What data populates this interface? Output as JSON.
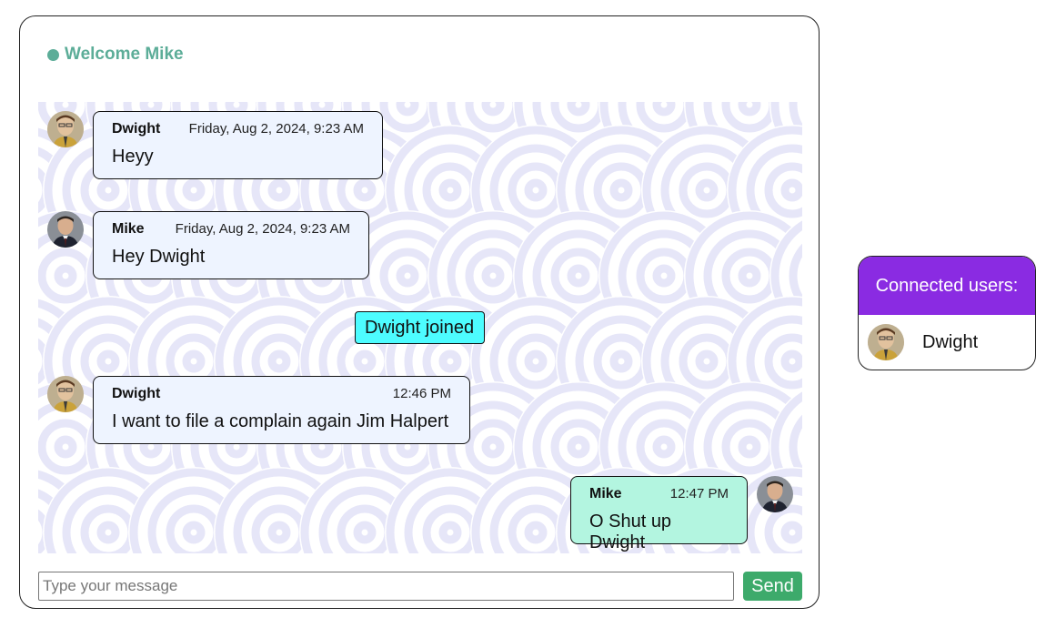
{
  "header": {
    "welcome_text": "Welcome Mike",
    "status_icon": "online-dot-icon",
    "accent_color": "#5cad98"
  },
  "messages": [
    {
      "type": "chat",
      "side": "left",
      "sender": "Dwight",
      "time": "Friday, Aug 2, 2024, 9:23 AM",
      "text": "Heyy",
      "avatar": "dwight-avatar",
      "bubble_color": "#eef4ff"
    },
    {
      "type": "chat",
      "side": "left",
      "sender": "Mike",
      "time": "Friday, Aug 2, 2024, 9:23 AM",
      "text": "Hey Dwight",
      "avatar": "mike-avatar",
      "bubble_color": "#eef4ff"
    },
    {
      "type": "system",
      "text": "Dwight joined",
      "bubble_color": "#4dfcff"
    },
    {
      "type": "chat",
      "side": "left",
      "sender": "Dwight",
      "time": "12:46 PM",
      "text": "I want to file a complain again Jim Halpert",
      "avatar": "dwight-avatar",
      "bubble_color": "#eef4ff"
    },
    {
      "type": "chat",
      "side": "right",
      "sender": "Mike",
      "time": "12:47 PM",
      "text": "O Shut up Dwight",
      "avatar": "mike-avatar",
      "bubble_color": "#b3f5e0"
    }
  ],
  "composer": {
    "placeholder": "Type your message",
    "value": "",
    "send_label": "Send",
    "send_color": "#3daa6b"
  },
  "connected_users": {
    "title": "Connected users:",
    "header_color": "#8a2be2",
    "users": [
      {
        "name": "Dwight",
        "avatar": "dwight-avatar"
      }
    ]
  },
  "colors": {
    "pattern_stroke": "#e6e6f8",
    "bubble_default": "#eef4ff"
  }
}
